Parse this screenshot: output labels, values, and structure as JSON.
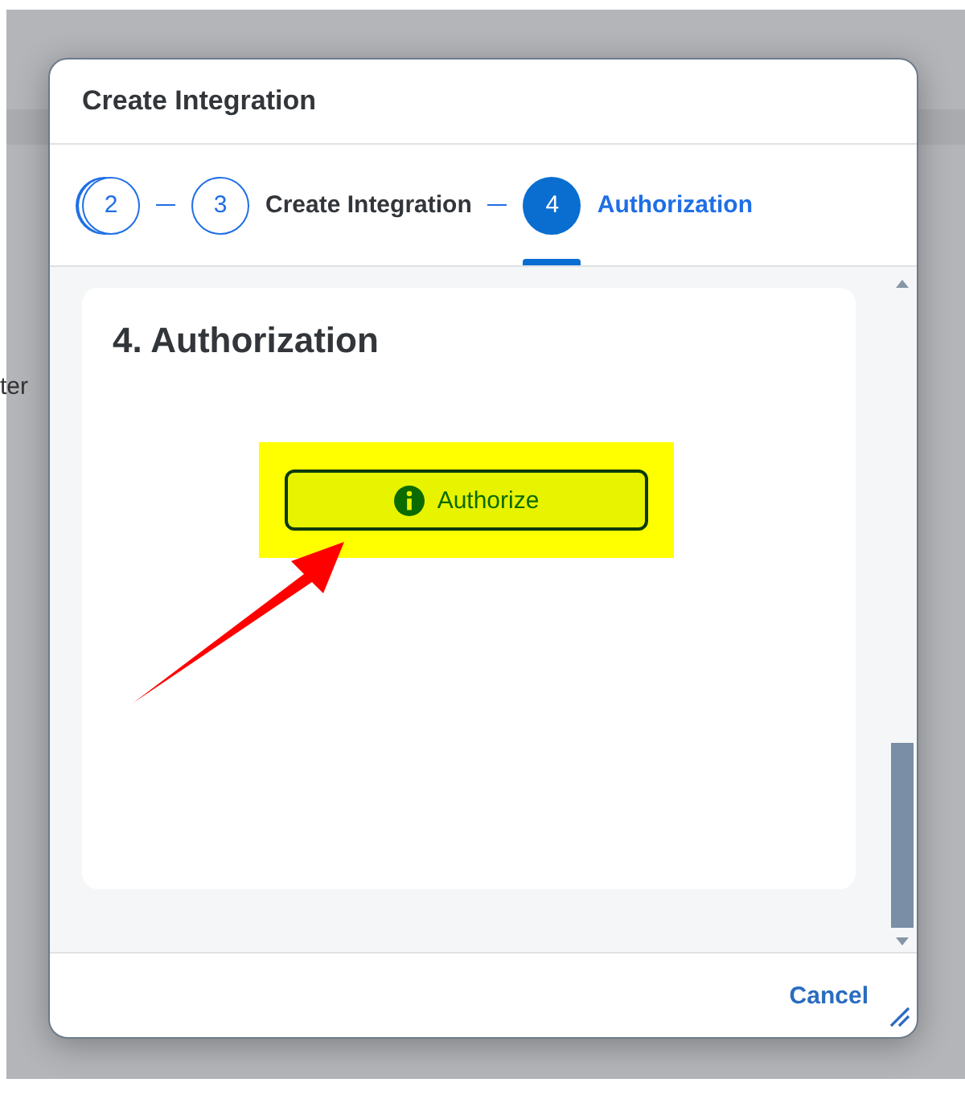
{
  "background": {
    "text": "ter"
  },
  "dialog": {
    "title": "Create Integration",
    "steps": [
      {
        "number": "2",
        "selected": false,
        "stacked": true
      },
      {
        "number": "3",
        "label": "Create Integration",
        "selected": false,
        "stacked": false
      },
      {
        "number": "4",
        "label": "Authorization",
        "selected": true,
        "stacked": false
      }
    ],
    "section_title": "4. Authorization",
    "authorize_button": {
      "label": "Authorize",
      "highlighted": true
    },
    "footer": {
      "cancel": "Cancel"
    }
  }
}
